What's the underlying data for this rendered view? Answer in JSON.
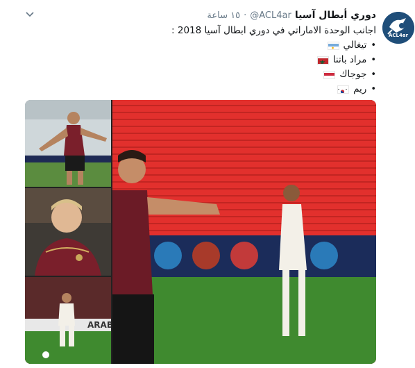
{
  "account": {
    "name": "دوري أبطال آسيا",
    "handle": "@ACL4ar",
    "separator": "·",
    "time": "١٥ ساعة",
    "avatar_text": "ACL4ar"
  },
  "tweet": {
    "text": "اجانب الوحدة الاماراتي في دوري ابطال آسيا 2018 :",
    "bullet": "•",
    "players": [
      {
        "name": "تيغالي",
        "flag": "argentina-flag"
      },
      {
        "name": "مراد باتنا",
        "flag": "morocco-flag"
      },
      {
        "name": "جوجاك",
        "flag": "hungary-flag"
      },
      {
        "name": "ريم",
        "flag": "south-korea-flag"
      }
    ]
  },
  "media": {
    "banner_text": "ARABI"
  },
  "colors": {
    "link": "#1da1f2",
    "muted": "#657786",
    "kit": "#7a1f2b",
    "stand": "#e2302d",
    "pitch": "#3f8a2f"
  }
}
